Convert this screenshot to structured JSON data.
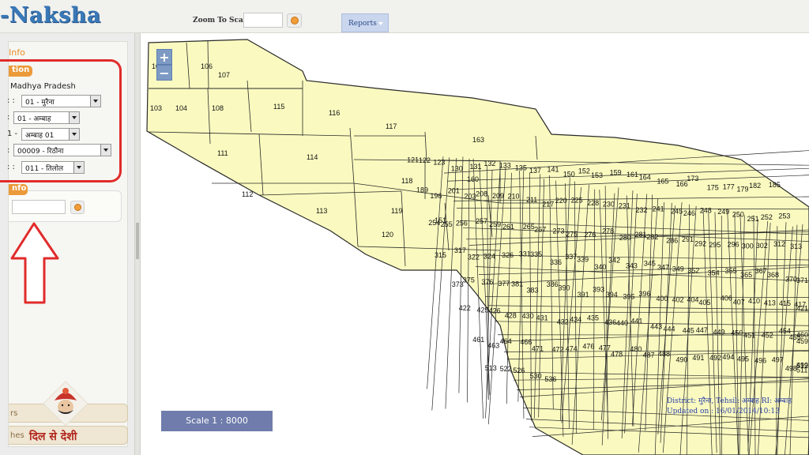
{
  "header": {
    "logo": "-Naksha",
    "zoom_label": "Zoom To Scale:",
    "zoom_value": "",
    "reports_label": "Reports"
  },
  "sidebar": {
    "info_title": "Info",
    "location_badge": "tion",
    "state": "Madhya Pradesh",
    "rows": [
      {
        "prefix": ": :",
        "value": "01 - मुरैना"
      },
      {
        "prefix": ":",
        "value": "01 - अम्बाह"
      },
      {
        "prefix": "1 -",
        "value": "अम्बाह 01"
      },
      {
        "prefix": ":",
        "value": "00009 - रिठौना"
      },
      {
        "prefix": ": :",
        "value": "011 - तिलोल"
      }
    ],
    "plot_badge": "nfo",
    "plot_value": "",
    "accordion": [
      "rs",
      "hes"
    ],
    "brand_tagline": "दिल से देशी"
  },
  "map": {
    "scale": "Scale 1 : 8000",
    "info_line1": "District: मुरैना, Tehsil: अम्बाह RI: अम्बाह",
    "info_line2": "Updated on : 16/01/2014/10:13",
    "plot_labels": [
      "109",
      "106",
      "107",
      "103",
      "104",
      "108",
      "115",
      "116",
      "117",
      "163",
      "111",
      "114",
      "112",
      "113",
      "118",
      "160",
      "119",
      "120",
      "151",
      "121",
      "122",
      "123",
      "130",
      "131",
      "132",
      "133",
      "135",
      "137",
      "141",
      "150",
      "152",
      "153",
      "159",
      "161",
      "164",
      "165",
      "166",
      "173",
      "175",
      "177",
      "179",
      "182",
      "185",
      "189",
      "196",
      "201",
      "203",
      "208",
      "209",
      "210",
      "211",
      "217",
      "220",
      "225",
      "228",
      "230",
      "231",
      "232",
      "241",
      "245",
      "246",
      "248",
      "249",
      "250",
      "251",
      "252",
      "253",
      "254",
      "255",
      "256",
      "257",
      "259",
      "261",
      "265",
      "267",
      "273",
      "275",
      "276",
      "278",
      "280",
      "281",
      "282",
      "286",
      "291",
      "292",
      "295",
      "296",
      "300",
      "302",
      "312",
      "313",
      "315",
      "317",
      "322",
      "324",
      "326",
      "331",
      "335",
      "336",
      "337",
      "339",
      "340",
      "342",
      "343",
      "345",
      "347",
      "349",
      "352",
      "354",
      "355",
      "365",
      "367",
      "368",
      "370",
      "371",
      "373",
      "375",
      "376",
      "377",
      "381",
      "383",
      "386",
      "390",
      "391",
      "393",
      "394",
      "395",
      "396",
      "400",
      "402",
      "404",
      "405",
      "406",
      "407",
      "410",
      "413",
      "415",
      "417",
      "421",
      "422",
      "425",
      "426",
      "428",
      "430",
      "431",
      "432",
      "434",
      "435",
      "436",
      "440",
      "441",
      "443",
      "444",
      "445",
      "447",
      "449",
      "450",
      "451",
      "452",
      "454",
      "455",
      "459",
      "460",
      "461",
      "463",
      "464",
      "466",
      "471",
      "472",
      "474",
      "476",
      "477",
      "478",
      "480",
      "487",
      "488",
      "490",
      "491",
      "492",
      "494",
      "495",
      "496",
      "497",
      "498",
      "499",
      "511",
      "512",
      "513",
      "522",
      "526",
      "530",
      "536"
    ],
    "colors": {
      "parcel": "#fafac0",
      "boundary": "#2a2a2a",
      "zoom_button": "#7d9ac4"
    }
  }
}
